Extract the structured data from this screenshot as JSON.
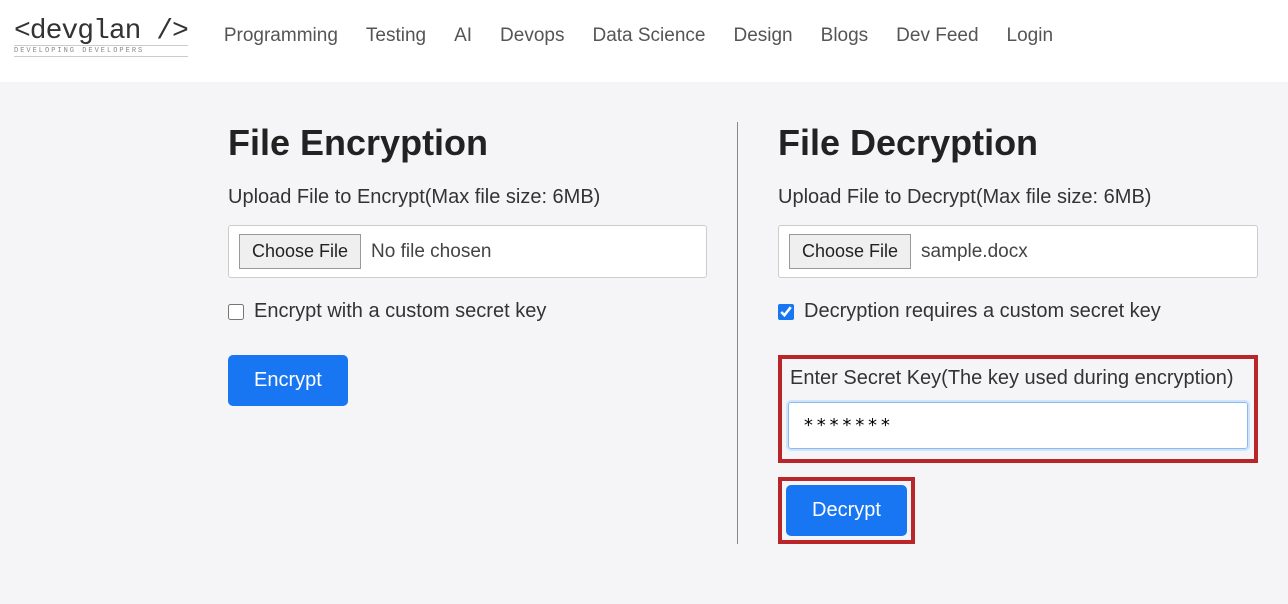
{
  "logo": {
    "main": "<devglan />",
    "sub": "DEVELOPING DEVELOPERS"
  },
  "nav": {
    "items": [
      "Programming",
      "Testing",
      "AI",
      "Devops",
      "Data Science",
      "Design",
      "Blogs",
      "Dev Feed",
      "Login"
    ]
  },
  "encryption": {
    "title": "File Encryption",
    "upload_label": "Upload File to Encrypt(Max file size: 6MB)",
    "choose_file": "Choose File",
    "file_name": "No file chosen",
    "custom_key_label": "Encrypt with a custom secret key",
    "custom_key_checked": false,
    "button": "Encrypt"
  },
  "decryption": {
    "title": "File Decryption",
    "upload_label": "Upload File to Decrypt(Max file size: 6MB)",
    "choose_file": "Choose File",
    "file_name": "sample.docx",
    "custom_key_label": "Decryption requires a custom secret key",
    "custom_key_checked": true,
    "secret_label": "Enter Secret Key(The key used during encryption)",
    "secret_value": "*******",
    "button": "Decrypt"
  }
}
